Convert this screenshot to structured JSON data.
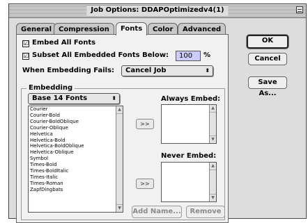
{
  "window": {
    "title": "Job Options: DDAPOptimizedv4(1)"
  },
  "tabs": [
    {
      "label": "General",
      "active": false
    },
    {
      "label": "Compression",
      "active": false
    },
    {
      "label": "Fonts",
      "active": true
    },
    {
      "label": "Color",
      "active": false
    },
    {
      "label": "Advanced",
      "active": false
    }
  ],
  "fonts": {
    "embed_all": {
      "label": "Embed All Fonts",
      "checked": true
    },
    "subset": {
      "label": "Subset All Embedded Fonts Below:",
      "checked": true,
      "value": "100",
      "unit": "%"
    },
    "when_fails": {
      "label": "When Embedding Fails:",
      "value": "Cancel Job"
    },
    "embedding": {
      "group_label": "Embedding",
      "font_set": "Base 14 Fonts",
      "available_fonts": [
        "Courier",
        "Courier-Bold",
        "Courier-BoldOblique",
        "Courier-Oblique",
        "Helvetica",
        "Helvetica-Bold",
        "Helvetica-BoldOblique",
        "Helvetica-Oblique",
        "Symbol",
        "Times-Bold",
        "Times-BoldItalic",
        "Times-Italic",
        "Times-Roman",
        "ZapfDingbats"
      ],
      "always_embed_label": "Always Embed:",
      "never_embed_label": "Never Embed:",
      "add_arrow": ">>",
      "add_name_label": "Add Name...",
      "remove_label": "Remove"
    }
  },
  "buttons": {
    "ok": "OK",
    "cancel": "Cancel",
    "save_as": "Save As..."
  },
  "icons": {
    "checkmark": "☑",
    "popup_arrows": "⬍",
    "scroll_up": "▲",
    "scroll_down": "▼"
  }
}
